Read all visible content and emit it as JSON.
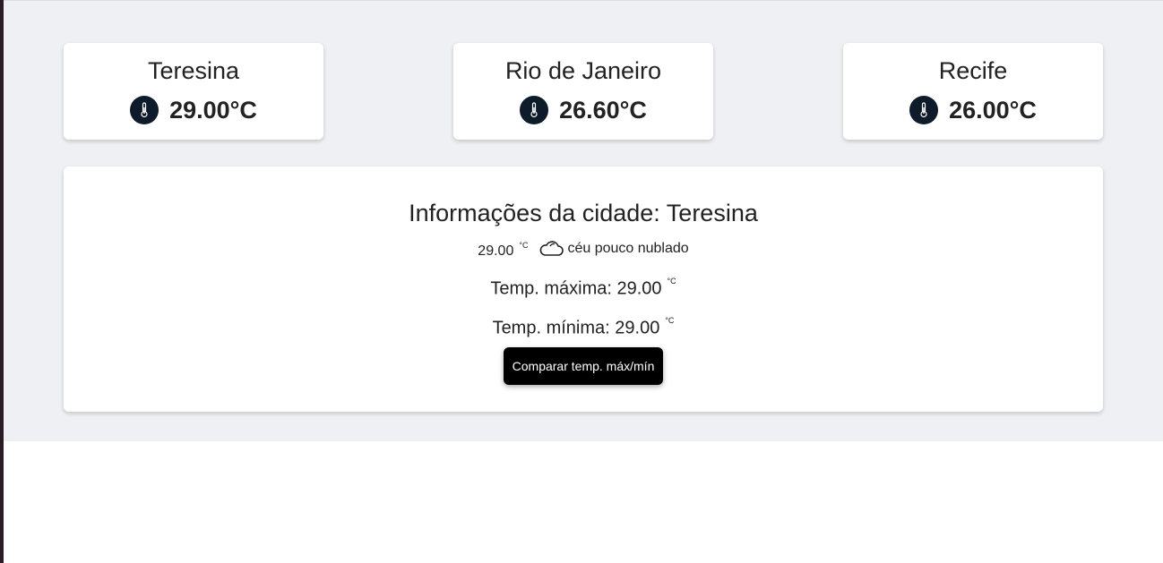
{
  "cities": [
    {
      "name": "Teresina",
      "temp": "29.00°C"
    },
    {
      "name": "Rio de Janeiro",
      "temp": "26.60°C"
    },
    {
      "name": "Recife",
      "temp": "26.00°C"
    }
  ],
  "icons": {
    "thermometer": "thermometer-icon",
    "cloud": "cloud-icon"
  },
  "details": {
    "title": "Informações da cidade: Teresina",
    "current_temp": "29.00",
    "unit": "°C",
    "description": "céu pouco nublado",
    "max_label": "Temp. máxima: 29.00",
    "min_label": "Temp. mínima: 29.00",
    "compare_button": "Comparar temp. máx/mín"
  },
  "colors": {
    "background": "#eff0f3",
    "card": "#ffffff",
    "thermometer_bg": "#0d1b2a",
    "button_bg": "#000000"
  }
}
